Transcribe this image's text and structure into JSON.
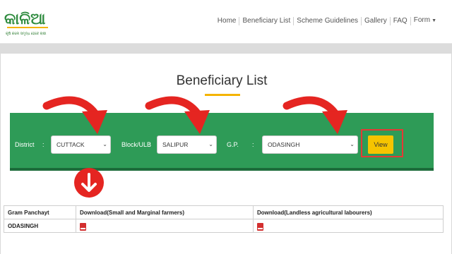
{
  "header": {
    "logo_text": "କାଳିଆ",
    "logo_tagline": "କୃଷି କଲେ ସମୃଦ୍ଧ ହେବେ ଚାଷୀ",
    "nav": [
      {
        "label": "Home"
      },
      {
        "label": "Beneficiary List"
      },
      {
        "label": "Scheme Guidelines"
      },
      {
        "label": "Gallery"
      },
      {
        "label": "FAQ"
      },
      {
        "label": "Form"
      }
    ]
  },
  "page": {
    "title": "Beneficiary List"
  },
  "filters": {
    "district_label": "District",
    "district_value": "CUTTACK",
    "block_label": "Block/ULB",
    "block_value": "SALIPUR",
    "gp_label": "G.P.",
    "gp_value": "ODASINGH",
    "colon": ":",
    "view_label": "View"
  },
  "table": {
    "headers": [
      "Gram Panchayt",
      "Download(Small and Marginal farmers)",
      "Download(Landless agricultural labourers)"
    ],
    "rows": [
      {
        "gram_panchayat": "ODASINGH"
      }
    ]
  },
  "colors": {
    "green": "#2e9b57",
    "accent_yellow": "#f6c400",
    "annotation_red": "#e52521"
  },
  "icons": [
    "chevron-down-icon",
    "pdf-icon",
    "red-arrow-icon",
    "down-arrow-badge-icon"
  ]
}
